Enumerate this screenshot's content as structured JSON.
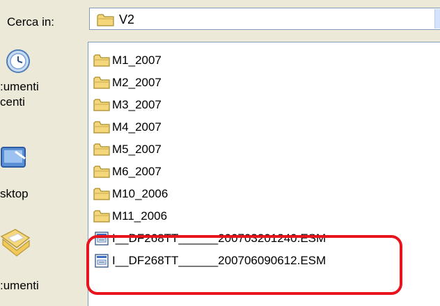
{
  "dialog": {
    "look_in_label": "Cerca in:",
    "current_folder": "V2"
  },
  "places": [
    {
      "label": ":umenti\ncenti",
      "icon": "recent-documents-icon"
    },
    {
      "label": "sktop",
      "icon": "desktop-icon"
    },
    {
      "label": ":umenti",
      "icon": "my-documents-icon"
    }
  ],
  "files": [
    {
      "name": "M1_2007",
      "type": "folder"
    },
    {
      "name": "M2_2007",
      "type": "folder"
    },
    {
      "name": "M3_2007",
      "type": "folder"
    },
    {
      "name": "M4_2007",
      "type": "folder"
    },
    {
      "name": "M5_2007",
      "type": "folder"
    },
    {
      "name": "M6_2007",
      "type": "folder"
    },
    {
      "name": "M10_2006",
      "type": "folder"
    },
    {
      "name": "M11_2006",
      "type": "folder"
    },
    {
      "name": "I__DF268TT______200703201240.ESM",
      "type": "file"
    },
    {
      "name": "I__DF268TT______200706090612.ESM",
      "type": "file"
    }
  ],
  "colors": {
    "highlight": "#e8141d",
    "folder": "#f3d77a"
  }
}
